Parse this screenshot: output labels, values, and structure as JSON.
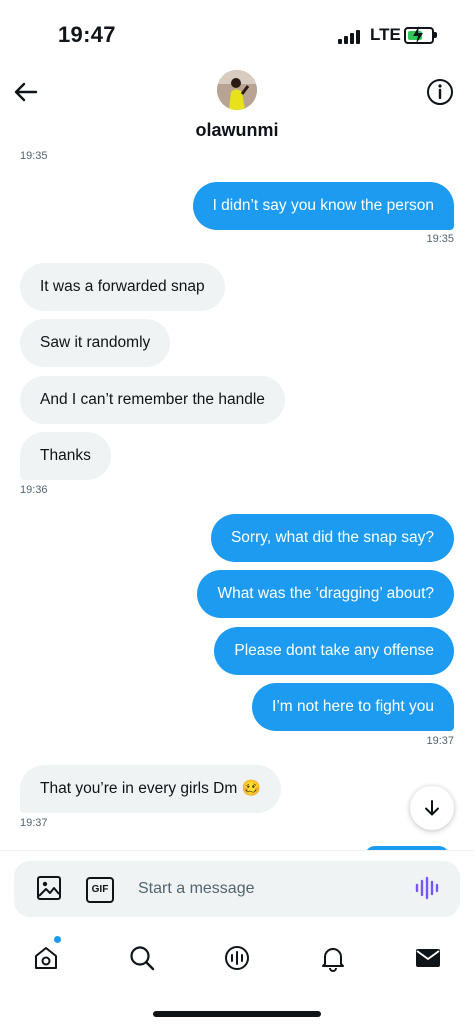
{
  "status_bar": {
    "time": "19:47",
    "network": "LTE"
  },
  "header": {
    "contact_name": "olawunmi"
  },
  "messages": {
    "ts_top": "19:35",
    "m1": "I didn’t say you know the person",
    "ts1": "19:35",
    "m2": "It was a forwarded snap",
    "m3": "Saw it randomly",
    "m4": "And I can’t remember the handle",
    "m5": "Thanks",
    "ts2": "19:36",
    "m6": "Sorry, what did the snap say?",
    "m7": "What was the ‘dragging’ about?",
    "m8": "Please dont take any offense",
    "m9": "I’m not here to fight you",
    "ts3": "19:37",
    "m10": "That you’re in every girls Dm 🥴",
    "ts4": "19:37"
  },
  "composer": {
    "placeholder": "Start a message",
    "gif_label": "GIF"
  },
  "icons": {
    "back": "back-arrow-icon",
    "info": "info-icon",
    "scroll": "arrow-down-icon",
    "image": "image-icon",
    "voice": "voice-wave-icon",
    "home": "home-icon",
    "search": "search-icon",
    "spaces": "spaces-icon",
    "notifications": "bell-icon",
    "messages": "envelope-icon"
  },
  "colors": {
    "accent": "#1d9bf0",
    "incoming": "#eff3f4",
    "voice": "#7856ff"
  }
}
